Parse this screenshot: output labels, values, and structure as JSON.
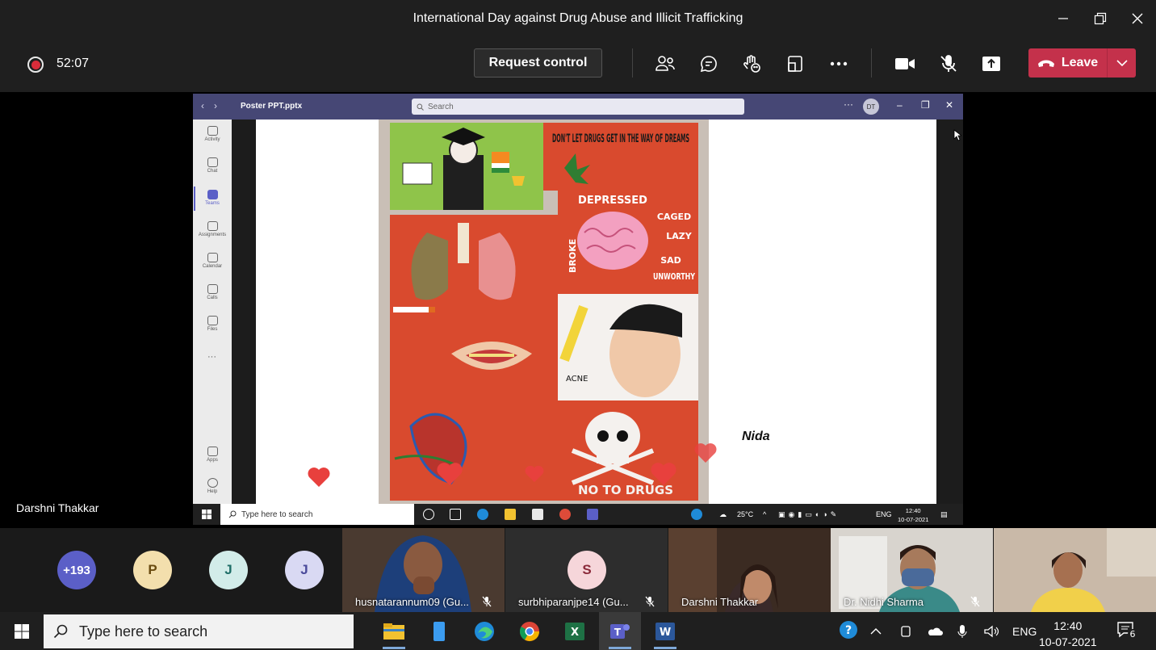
{
  "window": {
    "title": "International Day against Drug Abuse and Illicit Trafficking",
    "controls": [
      "minimize-icon",
      "restore-icon",
      "close-icon"
    ]
  },
  "toolbar": {
    "recording_timer": "52:07",
    "request_control_label": "Request control",
    "icons": [
      "participants-icon",
      "chat-icon",
      "reactions-icon",
      "share-tray-icon",
      "more-icon",
      "camera-icon",
      "mic-off-icon",
      "share-icon"
    ],
    "leave_label": "Leave",
    "leave_color": "#c4314b"
  },
  "shared_screen": {
    "presenter_name": "Darshni Thakkar",
    "file_name": "Poster PPT.pptx",
    "search_placeholder": "Search",
    "avatar_initials": "DT",
    "rail": [
      {
        "label": "Activity"
      },
      {
        "label": "Chat"
      },
      {
        "label": "Teams"
      },
      {
        "label": "Assignments"
      },
      {
        "label": "Calendar"
      },
      {
        "label": "Calls"
      },
      {
        "label": "Files"
      },
      {
        "label": "Apps"
      },
      {
        "label": "Help"
      }
    ],
    "poster": {
      "headline": "DON'T LET DRUGS GET IN THE WAY OF DREAMS",
      "depressed": "DEPRESSED",
      "caged": "CAGED",
      "lazy": "LAZY",
      "sad": "SAD",
      "unworthy": "UNWORTHY",
      "broke": "BROKE",
      "acne": "ACNE",
      "no_drugs": "NO TO DRUGS"
    },
    "slide_caption": "Nida",
    "taskbar": {
      "search_placeholder": "Type here to search",
      "weather": "25°C",
      "lang": "ENG",
      "time": "12:40",
      "date": "10-07-2021"
    }
  },
  "participants": {
    "overflow_count": "+193",
    "avatars": [
      {
        "initial": "P",
        "color": "#f3dfad"
      },
      {
        "initial": "J",
        "color": "#d2ece9"
      },
      {
        "initial": "J",
        "color": "#d9d9f3"
      }
    ],
    "tiles": [
      {
        "name": "husnatarannum09 (Gu...",
        "muted": true
      },
      {
        "name": "surbhiparanjpe14 (Gu...",
        "initial": "S",
        "muted": true
      },
      {
        "name": "Darshni Thakkar",
        "muted": false
      },
      {
        "name": "Dr. Nidhi Sharma",
        "muted": true
      },
      {
        "name": "",
        "muted": false
      }
    ]
  },
  "taskbar": {
    "search_placeholder": "Type here to search",
    "lang": "ENG",
    "time": "12:40",
    "date": "10-07-2021",
    "notification_count": "6"
  }
}
